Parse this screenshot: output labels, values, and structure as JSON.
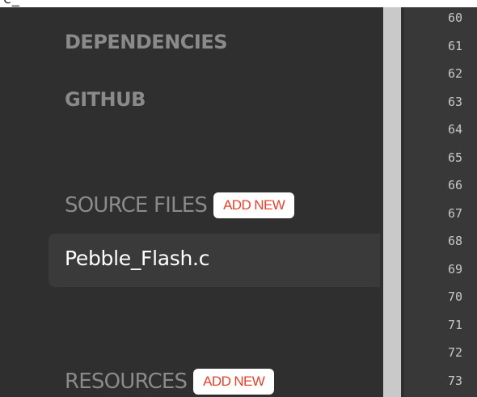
{
  "top_strip": {
    "text": "c_"
  },
  "sidebar": {
    "sections": {
      "dependencies": "DEPENDENCIES",
      "github": "GITHUB",
      "source_files": "SOURCE FILES",
      "resources": "RESOURCES"
    },
    "add_new_label": "ADD NEW",
    "source_files_items": [
      {
        "label": "Pebble_Flash.c"
      }
    ]
  },
  "editor": {
    "line_numbers": [
      "60",
      "61",
      "62",
      "63",
      "64",
      "65",
      "66",
      "67",
      "68",
      "69",
      "70",
      "71",
      "72",
      "73"
    ]
  },
  "colors": {
    "sidebar_bg": "#2f2f2f",
    "heading_gray": "#8a8a8a",
    "add_new_text": "#e8412c",
    "selected_item_bg": "#3a3a3a",
    "gutter_bg": "#383838"
  }
}
